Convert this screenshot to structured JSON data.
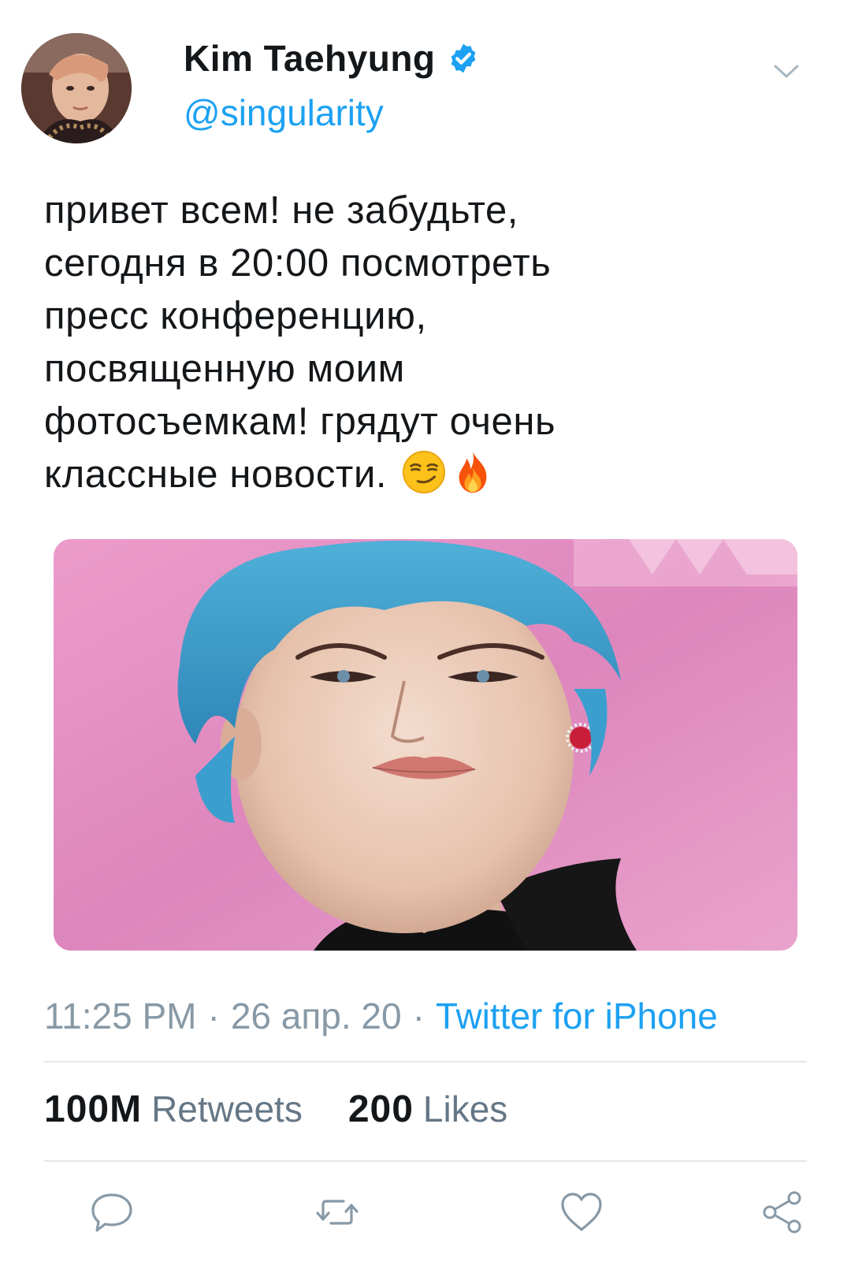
{
  "user": {
    "display_name": "Kim Taehyung",
    "handle": "@singularity",
    "verified": true
  },
  "tweet": {
    "text_lines": [
      "привет всем! не забудьте,",
      "сегодня в 20:00 посмотреть",
      "пресс конференцию,",
      "посвященную моим",
      "фотосъемкам! грядут очень",
      "классные новости."
    ],
    "emojis": [
      "smirking-face",
      "fire"
    ]
  },
  "meta": {
    "time": "11:25 PM",
    "date": "26 апр. 20",
    "separator": "·",
    "source": "Twitter for iPhone"
  },
  "stats": {
    "retweets_count": "100M",
    "retweets_label": "Retweets",
    "likes_count": "200",
    "likes_label": "Likes"
  },
  "colors": {
    "accent": "#1da1f2",
    "muted": "#8899a6",
    "text": "#14171a",
    "divider": "#e1e8ed"
  },
  "icons": {
    "verified": "verified-badge-icon",
    "menu": "chevron-down-icon",
    "reply": "reply-icon",
    "retweet": "retweet-icon",
    "like": "heart-icon",
    "share": "share-icon"
  }
}
